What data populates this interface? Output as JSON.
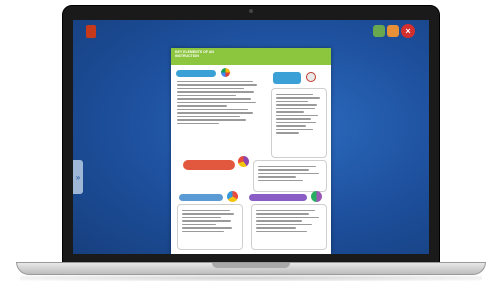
{
  "window": {
    "side_tab_glyph": "»",
    "close_glyph": "×"
  },
  "document": {
    "header_title": "KEY ELEMENTS OF AN INSTRUCTION",
    "header_subtitle": "",
    "sections": [
      {
        "label": "",
        "color": "#3aa0d6"
      },
      {
        "label": "",
        "color": "#3aa0d6"
      },
      {
        "label": "",
        "color": "#e2583e"
      },
      {
        "label": "",
        "color": "#5b9bd5"
      },
      {
        "label": "",
        "color": "#8a5cc6"
      }
    ]
  },
  "colors": {
    "screen": "#1d4f9c",
    "header_green": "#8cc63f",
    "close_red": "#d32f2f"
  }
}
